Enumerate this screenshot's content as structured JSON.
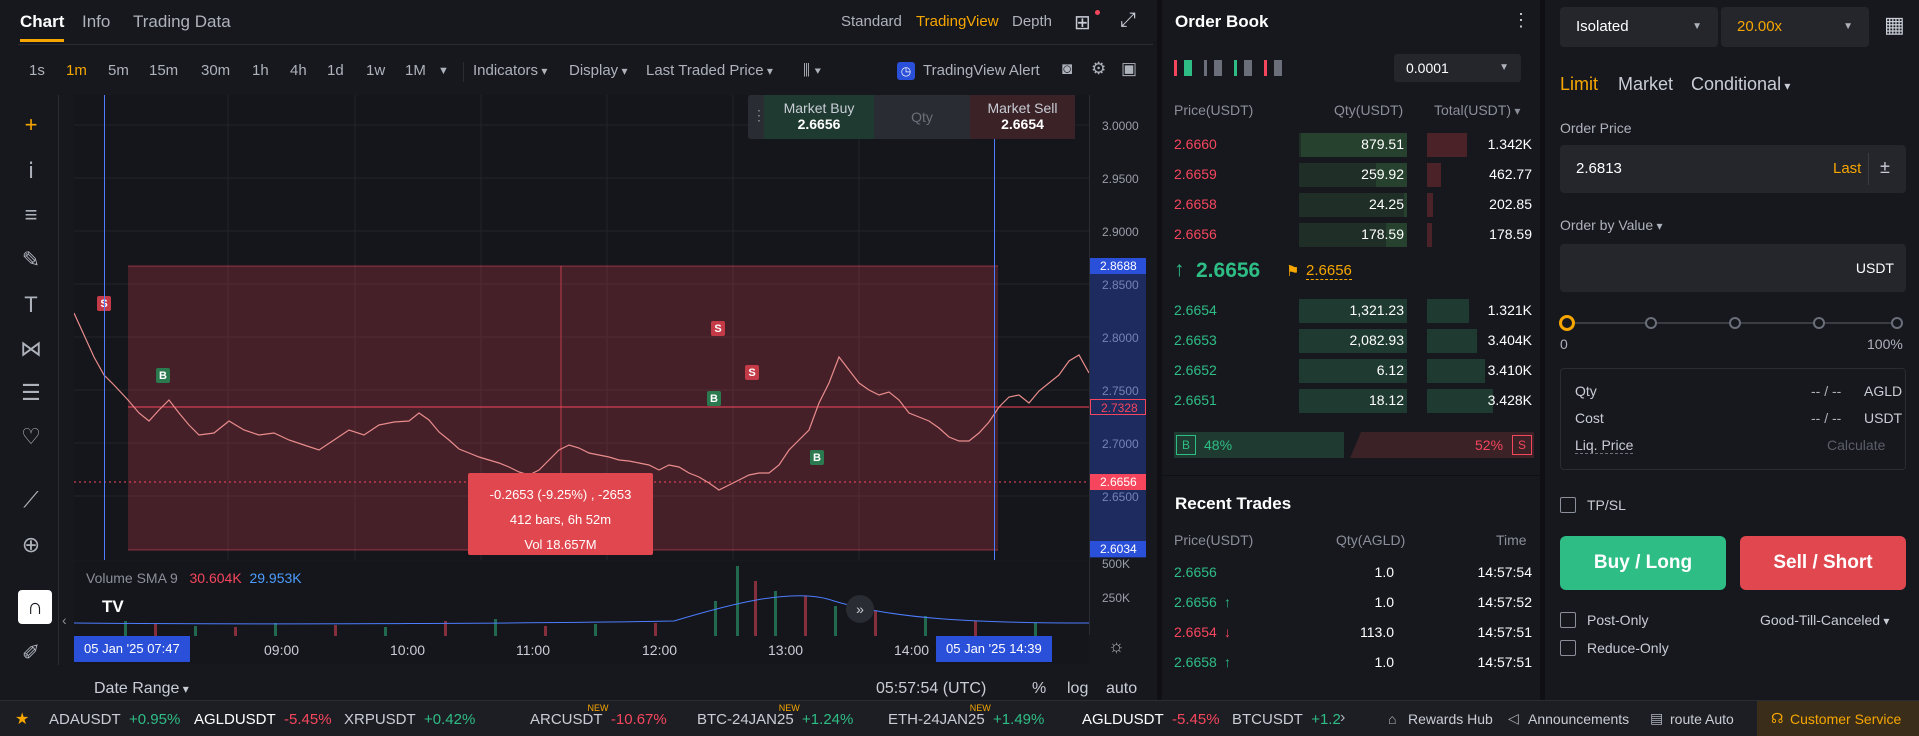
{
  "chart_tabs": {
    "chart": "Chart",
    "info": "Info",
    "trading_data": "Trading Data"
  },
  "view_tabs": {
    "standard": "Standard",
    "tradingview": "TradingView",
    "depth": "Depth"
  },
  "timeframes": [
    "1s",
    "1m",
    "5m",
    "15m",
    "30m",
    "1h",
    "4h",
    "1d",
    "1w",
    "1M"
  ],
  "toolbar": {
    "indicators": "Indicators",
    "display": "Display",
    "price_type": "Last Traded Price",
    "alert": "TradingView Alert"
  },
  "quick_order": {
    "buy_label": "Market Buy",
    "buy_price": "2.6656",
    "qty": "Qty",
    "sell_label": "Market Sell",
    "sell_price": "2.6654"
  },
  "price_axis": {
    "labels": [
      "3.0000",
      "2.9500",
      "2.9000",
      "2.8500",
      "2.8000",
      "2.7500",
      "2.7000",
      "2.6500",
      "500K",
      "250K"
    ],
    "tag_high": "2.8688",
    "tag_mid": "2.7328",
    "tag_last": "2.6656",
    "tag_low": "2.6034"
  },
  "range_box": {
    "line1": "-0.2653 (-9.25%) , -2653",
    "line2": "412 bars, 6h 52m",
    "line3": "Vol 18.657M"
  },
  "markers": [
    "S",
    "B",
    "B",
    "S",
    "S",
    "B"
  ],
  "volume": {
    "label": "Volume SMA 9",
    "v1": "30.604K",
    "v2": "29.953K"
  },
  "time_axis": {
    "start_tag": "05 Jan '25   07:47",
    "end_tag": "05 Jan '25   14:39",
    "labels": [
      "09:00",
      "10:00",
      "11:00",
      "12:00",
      "13:00",
      "14:00"
    ]
  },
  "bottom": {
    "date_range": "Date Range",
    "clock": "05:57:54 (UTC)",
    "pct": "%",
    "log": "log",
    "auto": "auto"
  },
  "orderbook": {
    "title": "Order Book",
    "precision": "0.0001",
    "headers": {
      "price": "Price(USDT)",
      "qty": "Qty(USDT)",
      "total": "Total(USDT)"
    },
    "asks": [
      [
        "2.6660",
        "879.51",
        "1.342K"
      ],
      [
        "2.6659",
        "259.92",
        "462.77"
      ],
      [
        "2.6658",
        "24.25",
        "202.85"
      ],
      [
        "2.6656",
        "178.59",
        "178.59"
      ]
    ],
    "mid": "2.6656",
    "mark": "2.6656",
    "bids": [
      [
        "2.6654",
        "1,321.23",
        "1.321K"
      ],
      [
        "2.6653",
        "2,082.93",
        "3.404K"
      ],
      [
        "2.6652",
        "6.12",
        "3.410K"
      ],
      [
        "2.6651",
        "18.12",
        "3.428K"
      ]
    ],
    "buy_pct": "48%",
    "sell_pct": "52%",
    "buy_letter": "B",
    "sell_letter": "S"
  },
  "recent_trades": {
    "title": "Recent Trades",
    "headers": {
      "price": "Price(USDT)",
      "qty": "Qty(AGLD)",
      "time": "Time"
    },
    "rows": [
      [
        "2.6656",
        "1.0",
        "14:57:54",
        "none"
      ],
      [
        "2.6656",
        "1.0",
        "14:57:52",
        "up"
      ],
      [
        "2.6654",
        "113.0",
        "14:57:51",
        "down"
      ],
      [
        "2.6658",
        "1.0",
        "14:57:51",
        "up"
      ]
    ]
  },
  "order_form": {
    "margin_mode": "Isolated",
    "leverage": "20.00x",
    "tabs": {
      "limit": "Limit",
      "market": "Market",
      "conditional": "Conditional"
    },
    "order_price_label": "Order Price",
    "order_price": "2.6813",
    "last": "Last",
    "order_by_value": "Order by Value",
    "unit": "USDT",
    "slider_min": "0",
    "slider_max": "100%",
    "slider_value": 0,
    "qty_label": "Qty",
    "qty_val": "-- / --",
    "qty_unit": "AGLD",
    "cost_label": "Cost",
    "cost_val": "-- / --",
    "cost_unit": "USDT",
    "liq_label": "Liq. Price",
    "liq_val": "Calculate",
    "tpsl": "TP/SL",
    "buy": "Buy / Long",
    "sell": "Sell / Short",
    "post_only": "Post-Only",
    "tif": "Good-Till-Canceled",
    "reduce_only": "Reduce-Only"
  },
  "ticker": [
    {
      "sym": "ADAUSDT",
      "chg": "+0.95%",
      "dir": "up",
      "new": false
    },
    {
      "sym": "AGLDUSDT",
      "chg": "-5.45%",
      "dir": "down",
      "new": false
    },
    {
      "sym": "XRPUSDT",
      "chg": "+0.42%",
      "dir": "up",
      "new": false
    },
    {
      "sym": "ARCUSDT",
      "chg": "-10.67%",
      "dir": "down",
      "new": true
    },
    {
      "sym": "BTC-24JAN25",
      "chg": "+1.24%",
      "dir": "up",
      "new": true
    },
    {
      "sym": "ETH-24JAN25",
      "chg": "+1.49%",
      "dir": "up",
      "new": true
    },
    {
      "sym": "AGLDUSDT",
      "chg": "-5.45%",
      "dir": "down",
      "new": false
    },
    {
      "sym": "BTCUSDT",
      "chg": "+1.2",
      "dir": "up",
      "new": false
    }
  ],
  "ticker_new": "NEW",
  "footer": {
    "rewards": "Rewards Hub",
    "announcements": "Announcements",
    "route": "route Auto",
    "service": "Customer Service"
  },
  "colors": {
    "accent": "#f7a600",
    "buy": "#2ebd85",
    "sell": "#f6465d",
    "blue": "#4c7dff"
  }
}
